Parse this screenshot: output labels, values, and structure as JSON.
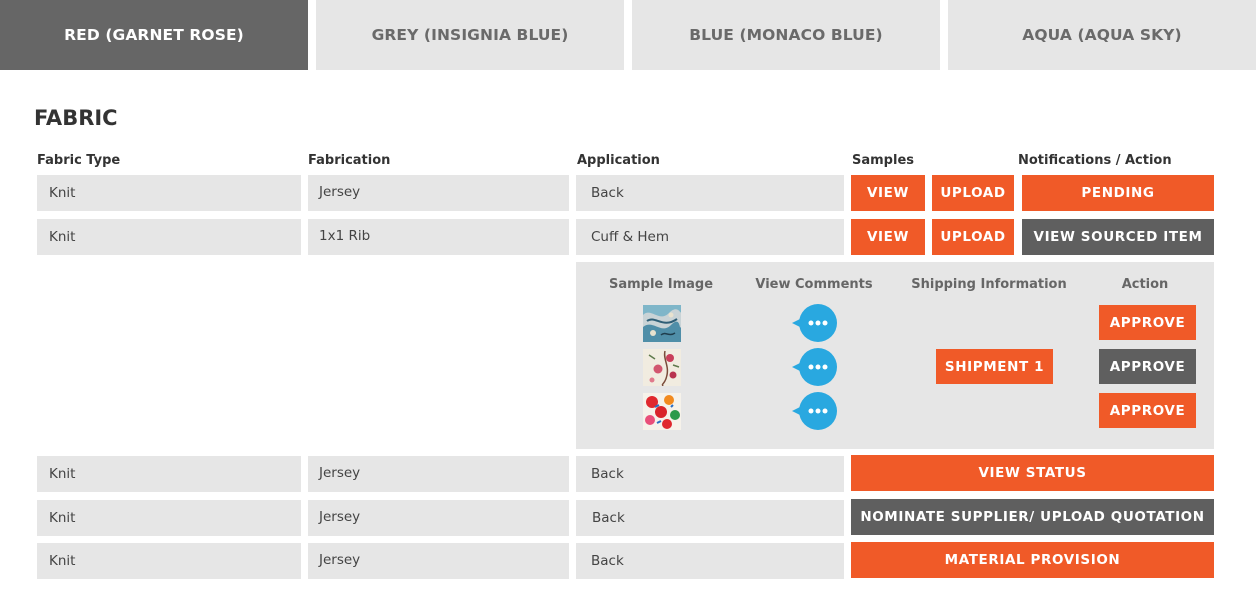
{
  "tabs": [
    {
      "label": "RED (GARNET ROSE)",
      "active": true
    },
    {
      "label": "GREY (INSIGNIA BLUE)",
      "active": false
    },
    {
      "label": "BLUE (MONACO BLUE)",
      "active": false
    },
    {
      "label": "AQUA (AQUA SKY)",
      "active": false
    }
  ],
  "section_title": "FABRIC",
  "columns": {
    "fabric_type": "Fabric Type",
    "fabrication": "Fabrication",
    "application": "Application",
    "samples": "Samples",
    "notifications": "Notifications / Action"
  },
  "rows": [
    {
      "fabric_type": "Knit",
      "fabrication": "Jersey",
      "application": "Back",
      "view": "VIEW",
      "upload": "UPLOAD",
      "action": "PENDING"
    },
    {
      "fabric_type": "Knit",
      "fabrication": "1x1 Rib",
      "application": "Cuff & Hem",
      "view": "VIEW",
      "upload": "UPLOAD",
      "action": "VIEW SOURCED ITEM"
    },
    {
      "fabric_type": "Knit",
      "fabrication": "Jersey",
      "application": "Back",
      "action": "VIEW STATUS"
    },
    {
      "fabric_type": "Knit",
      "fabrication": "Jersey",
      "application": "Back",
      "action": "NOMINATE SUPPLIER/ UPLOAD QUOTATION"
    },
    {
      "fabric_type": "Knit",
      "fabrication": "Jersey",
      "application": "Back",
      "action": "MATERIAL PROVISION"
    }
  ],
  "detail": {
    "headers": {
      "sample_image": "Sample Image",
      "view_comments": "View Comments",
      "shipping_information": "Shipping Information",
      "action": "Action"
    },
    "shipment_label": "SHIPMENT 1",
    "approve_labels": [
      "APPROVE",
      "APPROVE",
      "APPROVE"
    ],
    "thumbnails": [
      "sample-image-1",
      "sample-image-2",
      "sample-image-3"
    ]
  },
  "colors": {
    "accent": "#f05a28",
    "dark_button": "#5f5f5f",
    "active_tab": "#666666",
    "cell_bg": "#e6e6e6",
    "comment_icon": "#29a8e0"
  }
}
